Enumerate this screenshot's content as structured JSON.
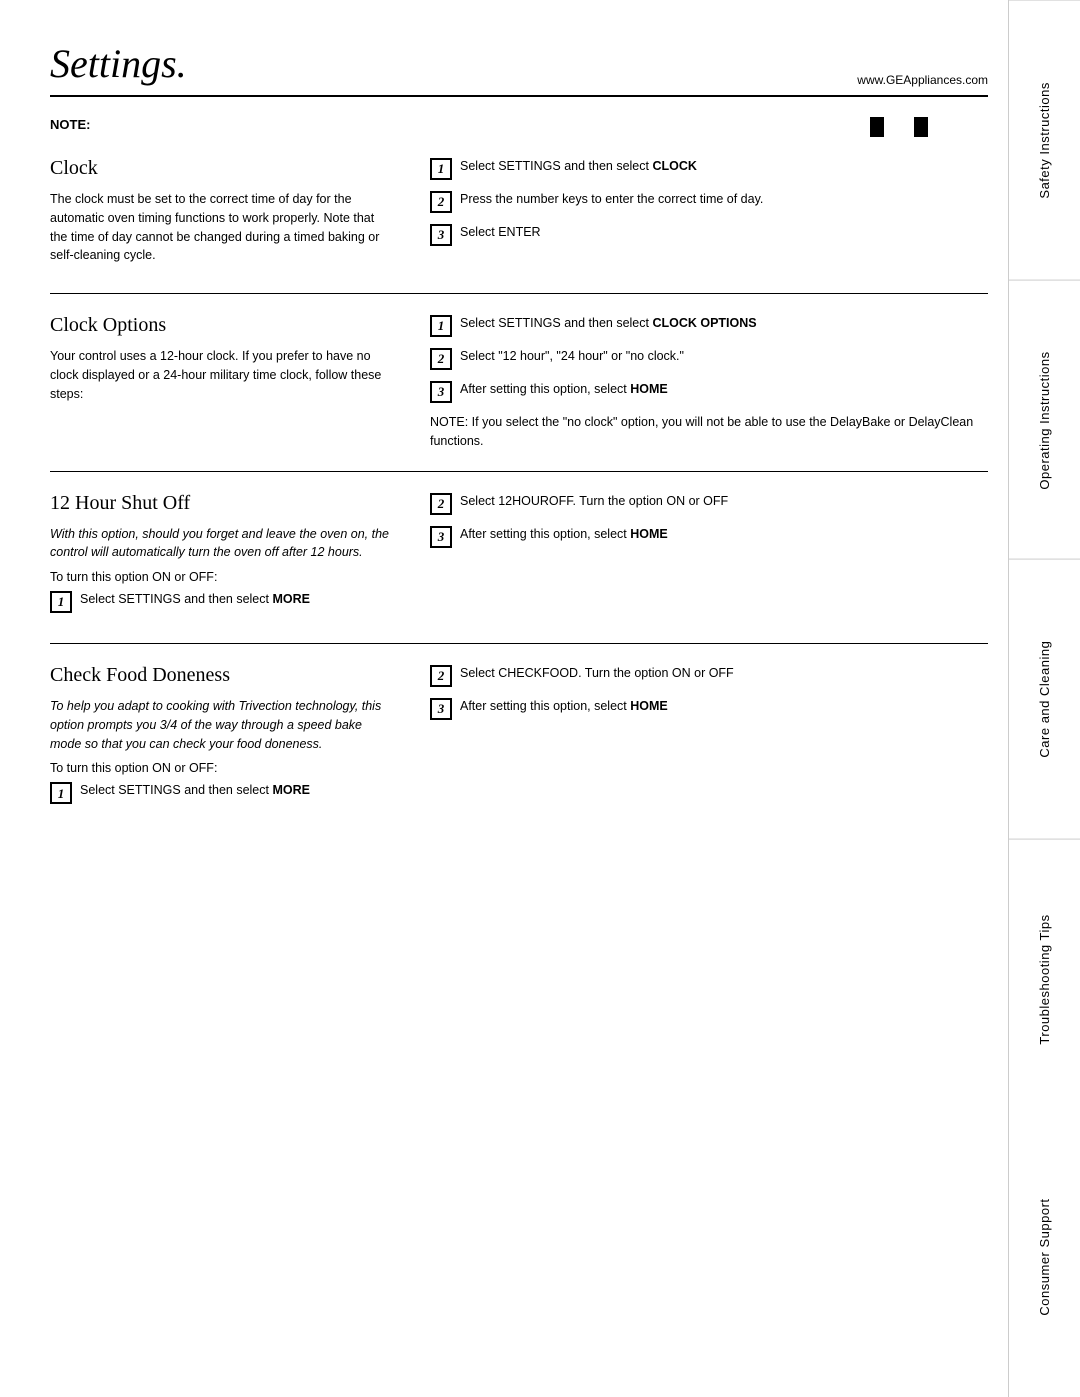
{
  "header": {
    "title": "Settings.",
    "website": "www.GEAppliances.com"
  },
  "note": {
    "label": "NOTE:"
  },
  "sidebar": {
    "sections": [
      "Safety Instructions",
      "Operating Instructions",
      "Care and Cleaning",
      "Troubleshooting Tips",
      "Consumer Support"
    ]
  },
  "sections": [
    {
      "id": "clock",
      "heading": "Clock",
      "body": "The clock must be set to the correct time of day for the automatic oven timing functions to work properly. Note that the time of day cannot be changed during a timed baking or self-cleaning cycle.",
      "steps": [
        {
          "num": "1",
          "text": "Select SETTINGS and then select CLOCK",
          "bold_part": "CLOCK"
        },
        {
          "num": "2",
          "text": "Press the number keys to enter the correct time of day."
        },
        {
          "num": "3",
          "text": "Select ENTER",
          "bold_part": ""
        }
      ]
    },
    {
      "id": "clock-options",
      "heading": "Clock Options",
      "body": "Your control uses a 12-hour clock. If you prefer to have no clock displayed or a 24-hour military time clock, follow these steps:",
      "steps": [
        {
          "num": "1",
          "text": "Select SETTINGS and then select CLOCK OPTIONS",
          "bold_part": "CLOCK OPTIONS"
        },
        {
          "num": "2",
          "text": "Select \"12 hour\", \"24 hour\" or \"no clock.\""
        },
        {
          "num": "3",
          "text": "After setting this option, select HOME",
          "bold_part": "HOME"
        }
      ],
      "note_inline": "NOTE: If you select the \"no clock\" option, you will not be able to use the DelayBake or DelayClean functions."
    },
    {
      "id": "12-hour-shut-off",
      "heading": "12 Hour Shut Off",
      "body_italic": "With this option, should you forget and leave the oven on, the control will automatically turn the oven off after 12 hours.",
      "to_turn": "To turn this option ON or OFF:",
      "steps_left": [
        {
          "num": "1",
          "text": "Select SETTINGS and then select MORE",
          "bold_part": "MORE"
        }
      ],
      "steps_right": [
        {
          "num": "2",
          "text": "Select 12HOUROFF. Turn the option ON or OFF"
        },
        {
          "num": "3",
          "text": "After setting this option, select HOME",
          "bold_part": "HOME"
        }
      ]
    },
    {
      "id": "check-food-doneness",
      "heading": "Check Food Doneness",
      "body_italic": "To help you adapt to cooking with Trivection technology, this option prompts you 3/4 of the way through a speed bake mode so that you can check your food doneness.",
      "to_turn": "To turn this option ON or OFF:",
      "steps_left": [
        {
          "num": "1",
          "text": "Select SETTINGS and then select MORE",
          "bold_part": "MORE"
        }
      ],
      "steps_right": [
        {
          "num": "2",
          "text": "Select CHECKFOOD. Turn the option ON or OFF"
        },
        {
          "num": "3",
          "text": "After setting this option, select HOME",
          "bold_part": "HOME"
        }
      ]
    }
  ]
}
